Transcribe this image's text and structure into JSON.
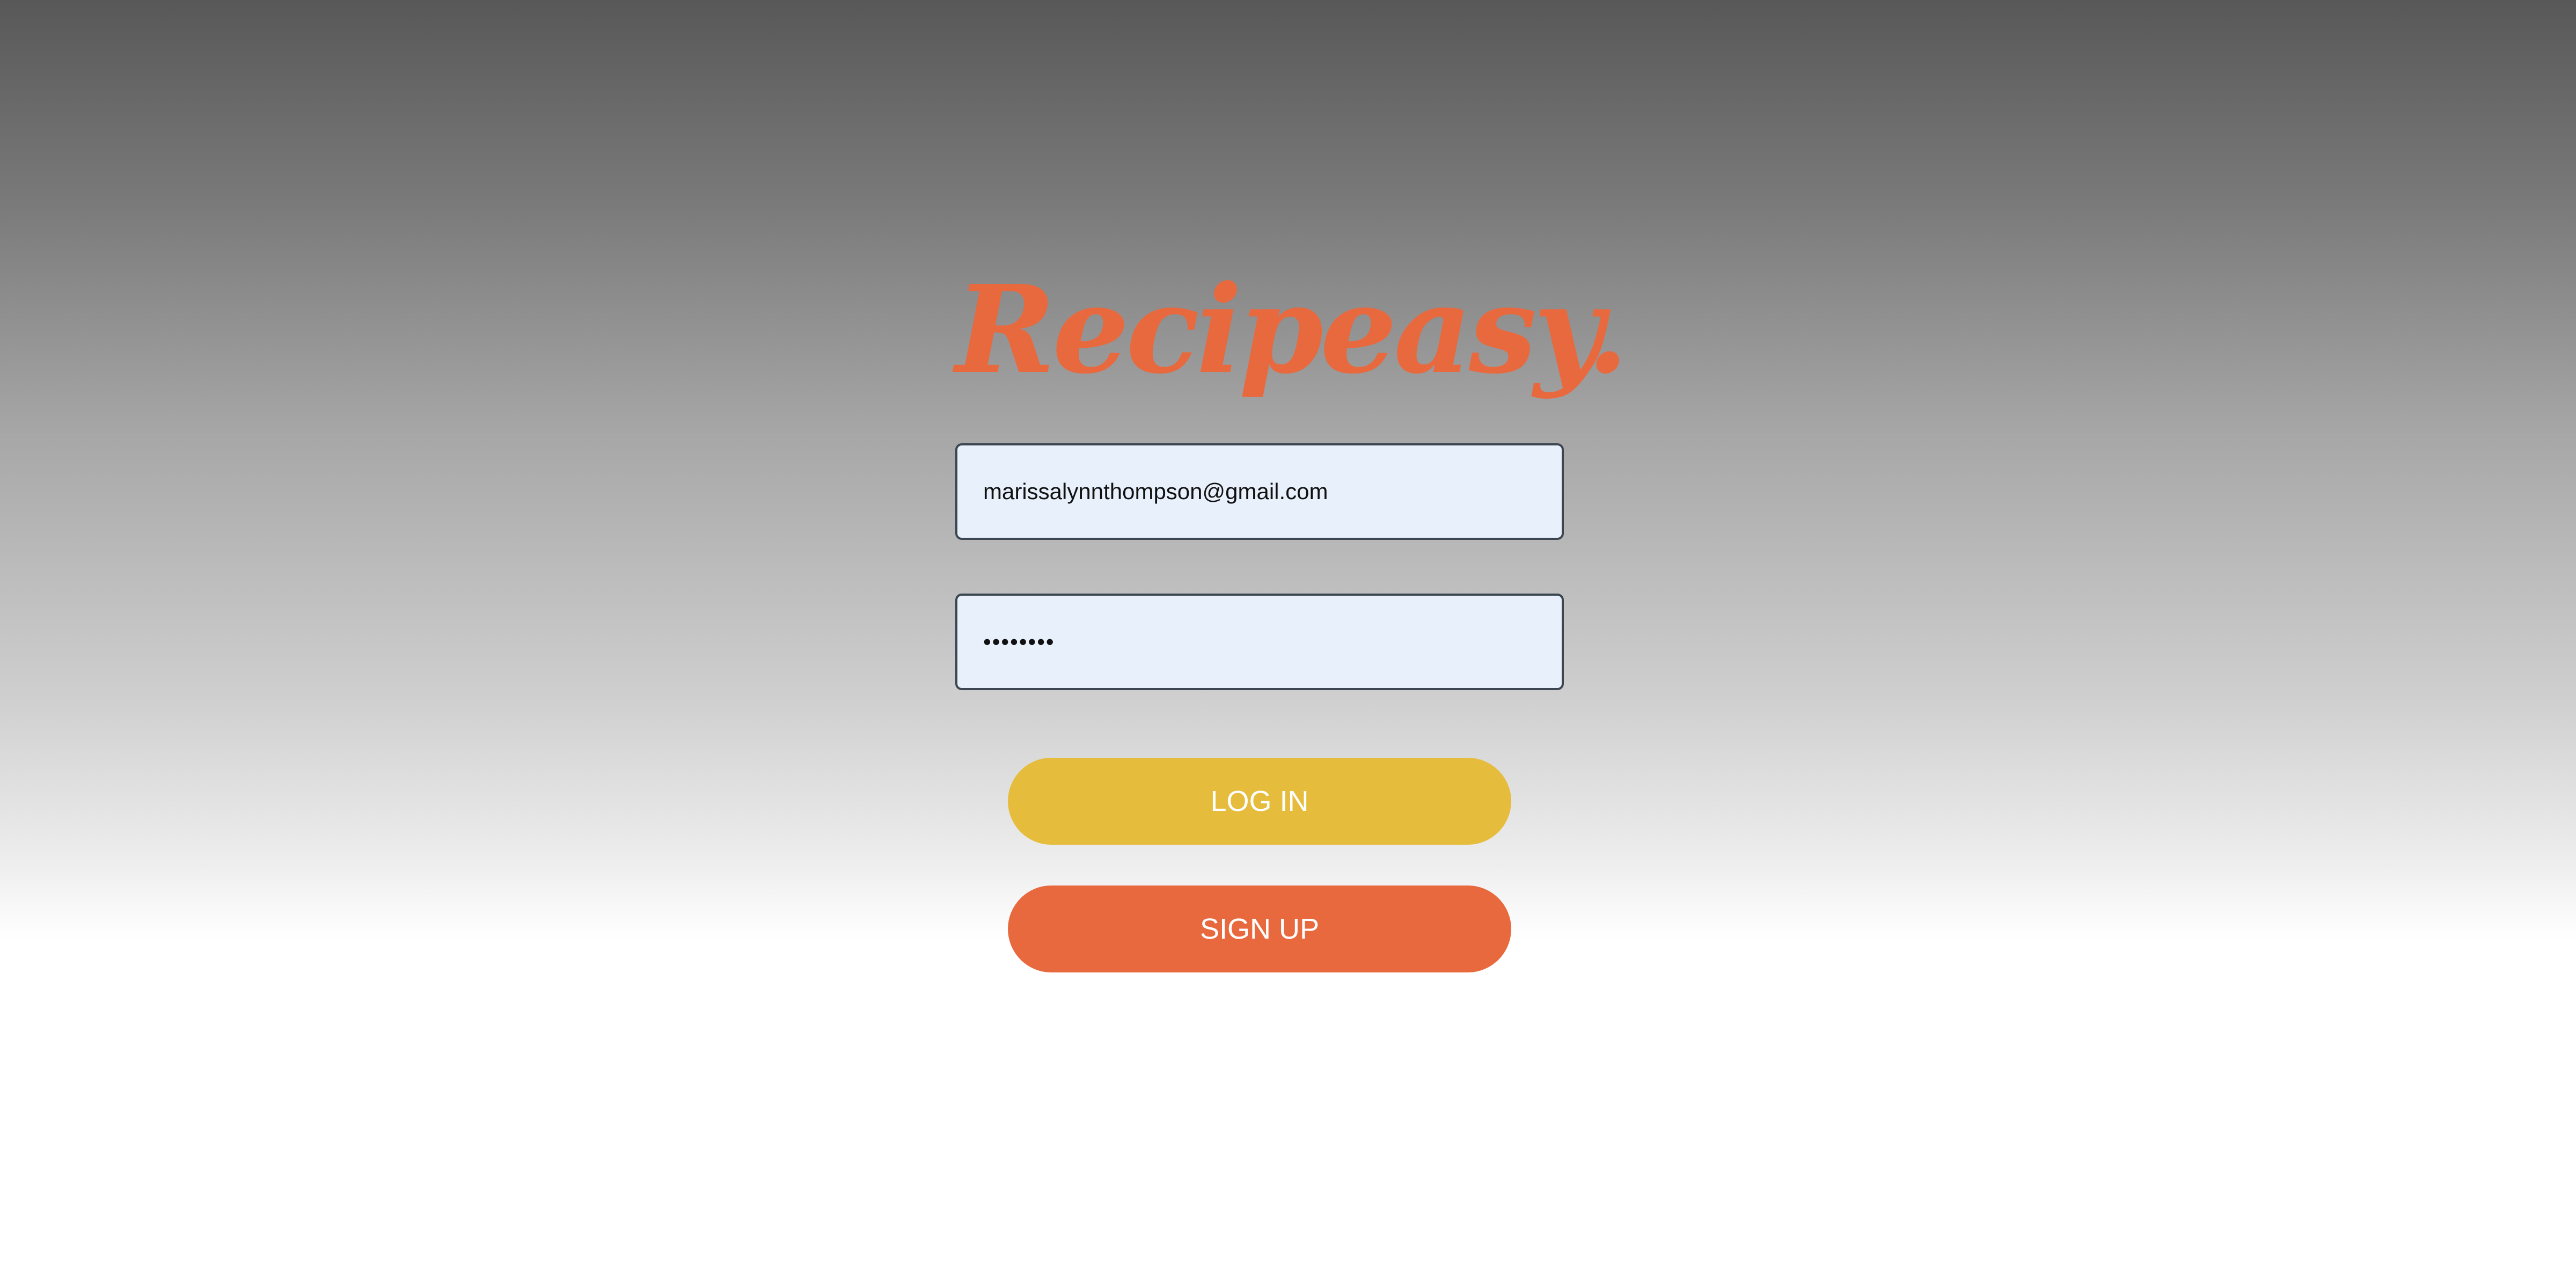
{
  "brand": {
    "logo_text": "Recipeasy.",
    "logo_color": "#e8693e"
  },
  "login_form": {
    "email_value": "marissalynnthompson@gmail.com",
    "password_value": "••••••••",
    "login_label": "LOG IN",
    "signup_label": "SIGN UP"
  },
  "colors": {
    "field_bg": "#e8f0fb",
    "login_button": "#e6bc3d",
    "signup_button": "#e8693e"
  }
}
